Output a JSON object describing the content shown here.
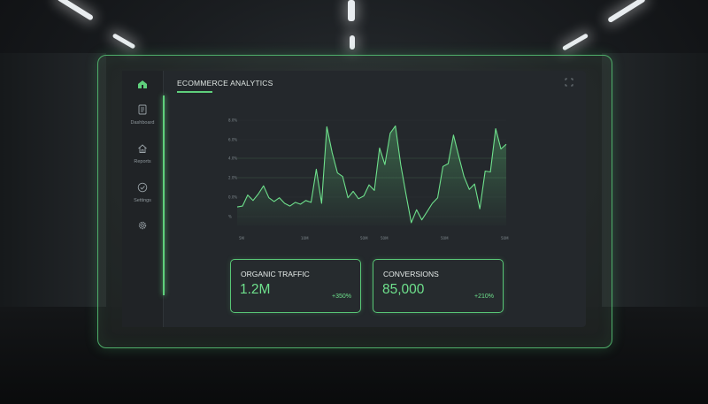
{
  "app": {
    "title": "ECOMMERCE ANALYTICS"
  },
  "sidebar": {
    "items": [
      {
        "label": "Dashboard",
        "icon": "document-icon"
      },
      {
        "label": "Reports",
        "icon": "home-icon"
      },
      {
        "label": "Settings",
        "icon": "check-circle-icon"
      },
      {
        "label": "",
        "icon": "gear-icon"
      }
    ]
  },
  "chart_data": {
    "type": "area",
    "y_tick_labels": [
      "8.0%",
      "6.0%",
      "4.0%",
      "2.0%",
      "0.0%",
      "%"
    ],
    "x_tick_labels": [
      "5M",
      "10M",
      "50M",
      "50M",
      "50M",
      "50M"
    ],
    "series": [
      {
        "values": [
          0.5,
          0.6,
          1.8,
          1.2,
          1.9,
          2.8,
          1.5,
          1.1,
          1.5,
          0.9,
          0.6,
          1.0,
          0.8,
          1.2,
          1.0,
          4.6,
          0.9,
          9.2,
          6.4,
          4.2,
          3.8,
          1.5,
          2.2,
          1.4,
          1.7,
          2.9,
          2.3,
          6.9,
          5.1,
          8.5,
          9.3,
          5.1,
          1.9,
          -1.2,
          0.2,
          -0.9,
          0.0,
          0.9,
          1.5,
          4.9,
          5.2,
          8.3,
          6.0,
          3.8,
          2.4,
          3.0,
          0.3,
          4.4,
          4.3,
          9.0,
          6.8,
          7.3
        ]
      }
    ],
    "accent_color": "#5fd07c"
  },
  "cards": [
    {
      "title": "ORGANIC TRAFFIC",
      "value": "1.2M",
      "change": "+350%"
    },
    {
      "title": "CONVERSIONS",
      "value": "85,000",
      "change": "+210%"
    }
  ]
}
